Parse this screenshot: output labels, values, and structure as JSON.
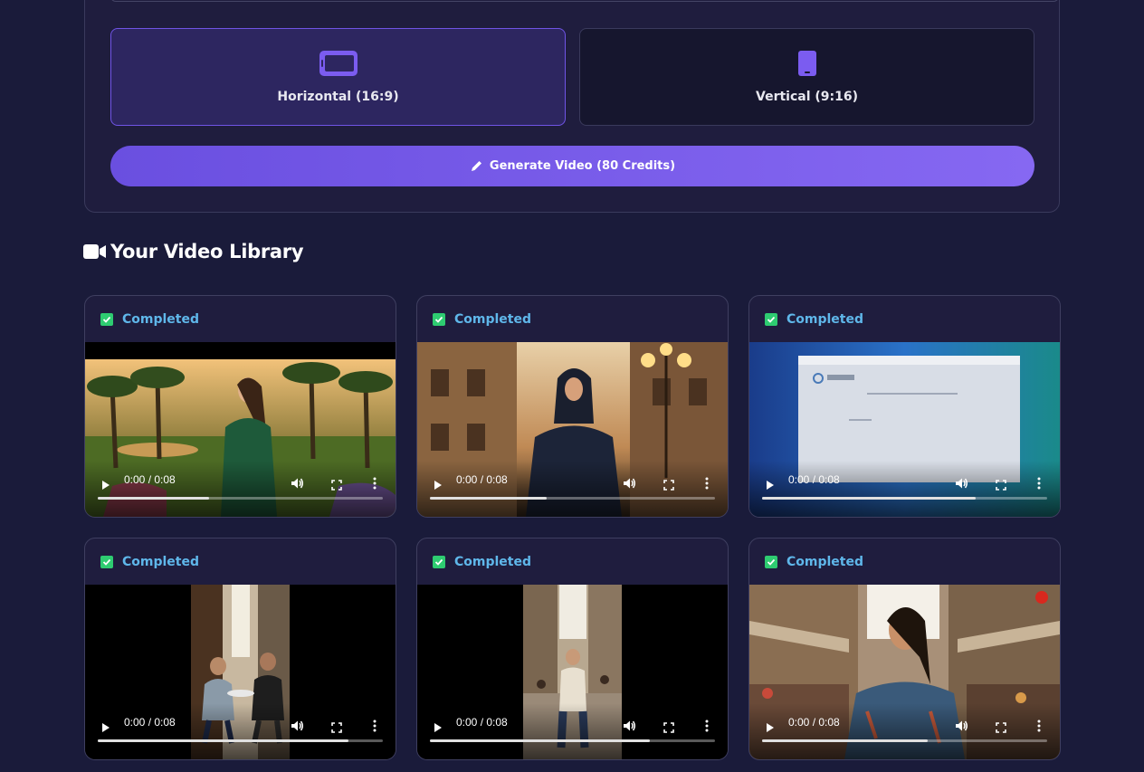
{
  "orientation": {
    "horizontal_label": "Horizontal (16:9)",
    "vertical_label": "Vertical (9:16)",
    "selected": "horizontal",
    "accent": "#7054e6"
  },
  "generate": {
    "label": "Generate Video (80 Credits)",
    "icon": "pencil-icon"
  },
  "library": {
    "title": "Your Video Library",
    "icon": "video-camera-icon",
    "status_color": "#5fb7ea",
    "check_color": "#2ecc71",
    "videos": [
      {
        "status": "Completed",
        "time": "0:00 / 0:08",
        "buffered": 0.39,
        "scene": "woman in green dress in palm garden"
      },
      {
        "status": "Completed",
        "time": "0:00 / 0:08",
        "buffered": 0.41,
        "scene": "woman in hijab on city street at dusk"
      },
      {
        "status": "Completed",
        "time": "0:00 / 0:08",
        "buffered": 0.75,
        "scene": "computer screen showing web page"
      },
      {
        "status": "Completed",
        "time": "0:00 / 0:08",
        "buffered": 0.88,
        "scene": "two men at cafe table in alley"
      },
      {
        "status": "Completed",
        "time": "0:00 / 0:08",
        "buffered": 0.77,
        "scene": "woman walking in busy street"
      },
      {
        "status": "Completed",
        "time": "0:00 / 0:08",
        "buffered": 0.58,
        "scene": "smiling woman in market street"
      }
    ]
  }
}
